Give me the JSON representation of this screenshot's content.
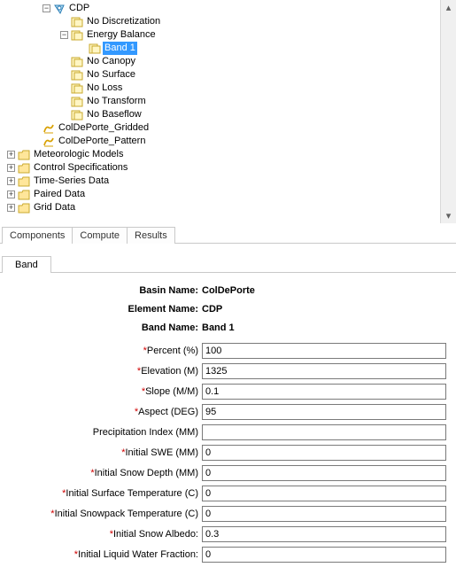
{
  "tree": {
    "cdp": "CDP",
    "no_discretization": "No Discretization",
    "energy_balance": "Energy Balance",
    "band1": "Band 1",
    "no_canopy": "No Canopy",
    "no_surface": "No Surface",
    "no_loss": "No Loss",
    "no_transform": "No Transform",
    "no_baseflow": "No Baseflow",
    "gridded": "ColDePorte_Gridded",
    "pattern": "ColDePorte_Pattern",
    "met_models": "Meteorologic Models",
    "ctrl_specs": "Control Specifications",
    "ts_data": "Time-Series Data",
    "paired_data": "Paired Data",
    "grid_data": "Grid Data"
  },
  "tabs1": {
    "components": "Components",
    "compute": "Compute",
    "results": "Results"
  },
  "tabs2": {
    "band": "Band"
  },
  "meta": {
    "basin_name_label": "Basin Name:",
    "basin_name_value": "ColDePorte",
    "element_name_label": "Element Name:",
    "element_name_value": "CDP",
    "band_name_label": "Band Name:",
    "band_name_value": "Band 1"
  },
  "fields": {
    "percent": {
      "label": "Percent (%)",
      "required": true,
      "value": "100"
    },
    "elevation": {
      "label": "Elevation (M)",
      "required": true,
      "value": "1325"
    },
    "slope": {
      "label": "Slope (M/M)",
      "required": true,
      "value": "0.1"
    },
    "aspect": {
      "label": "Aspect (DEG)",
      "required": true,
      "value": "95"
    },
    "precip_index": {
      "label": "Precipitation Index (MM)",
      "required": false,
      "value": ""
    },
    "init_swe": {
      "label": "Initial SWE (MM)",
      "required": true,
      "value": "0"
    },
    "init_snow_depth": {
      "label": "Initial Snow Depth (MM)",
      "required": true,
      "value": "0"
    },
    "init_surf_temp": {
      "label": "Initial Surface Temperature (C)",
      "required": true,
      "value": "0"
    },
    "init_pack_temp": {
      "label": "Initial Snowpack Temperature (C)",
      "required": true,
      "value": "0"
    },
    "init_albedo": {
      "label": "Initial Snow Albedo:",
      "required": true,
      "value": "0.3"
    },
    "init_liq_frac": {
      "label": "Initial Liquid Water Fraction:",
      "required": true,
      "value": "0"
    }
  }
}
